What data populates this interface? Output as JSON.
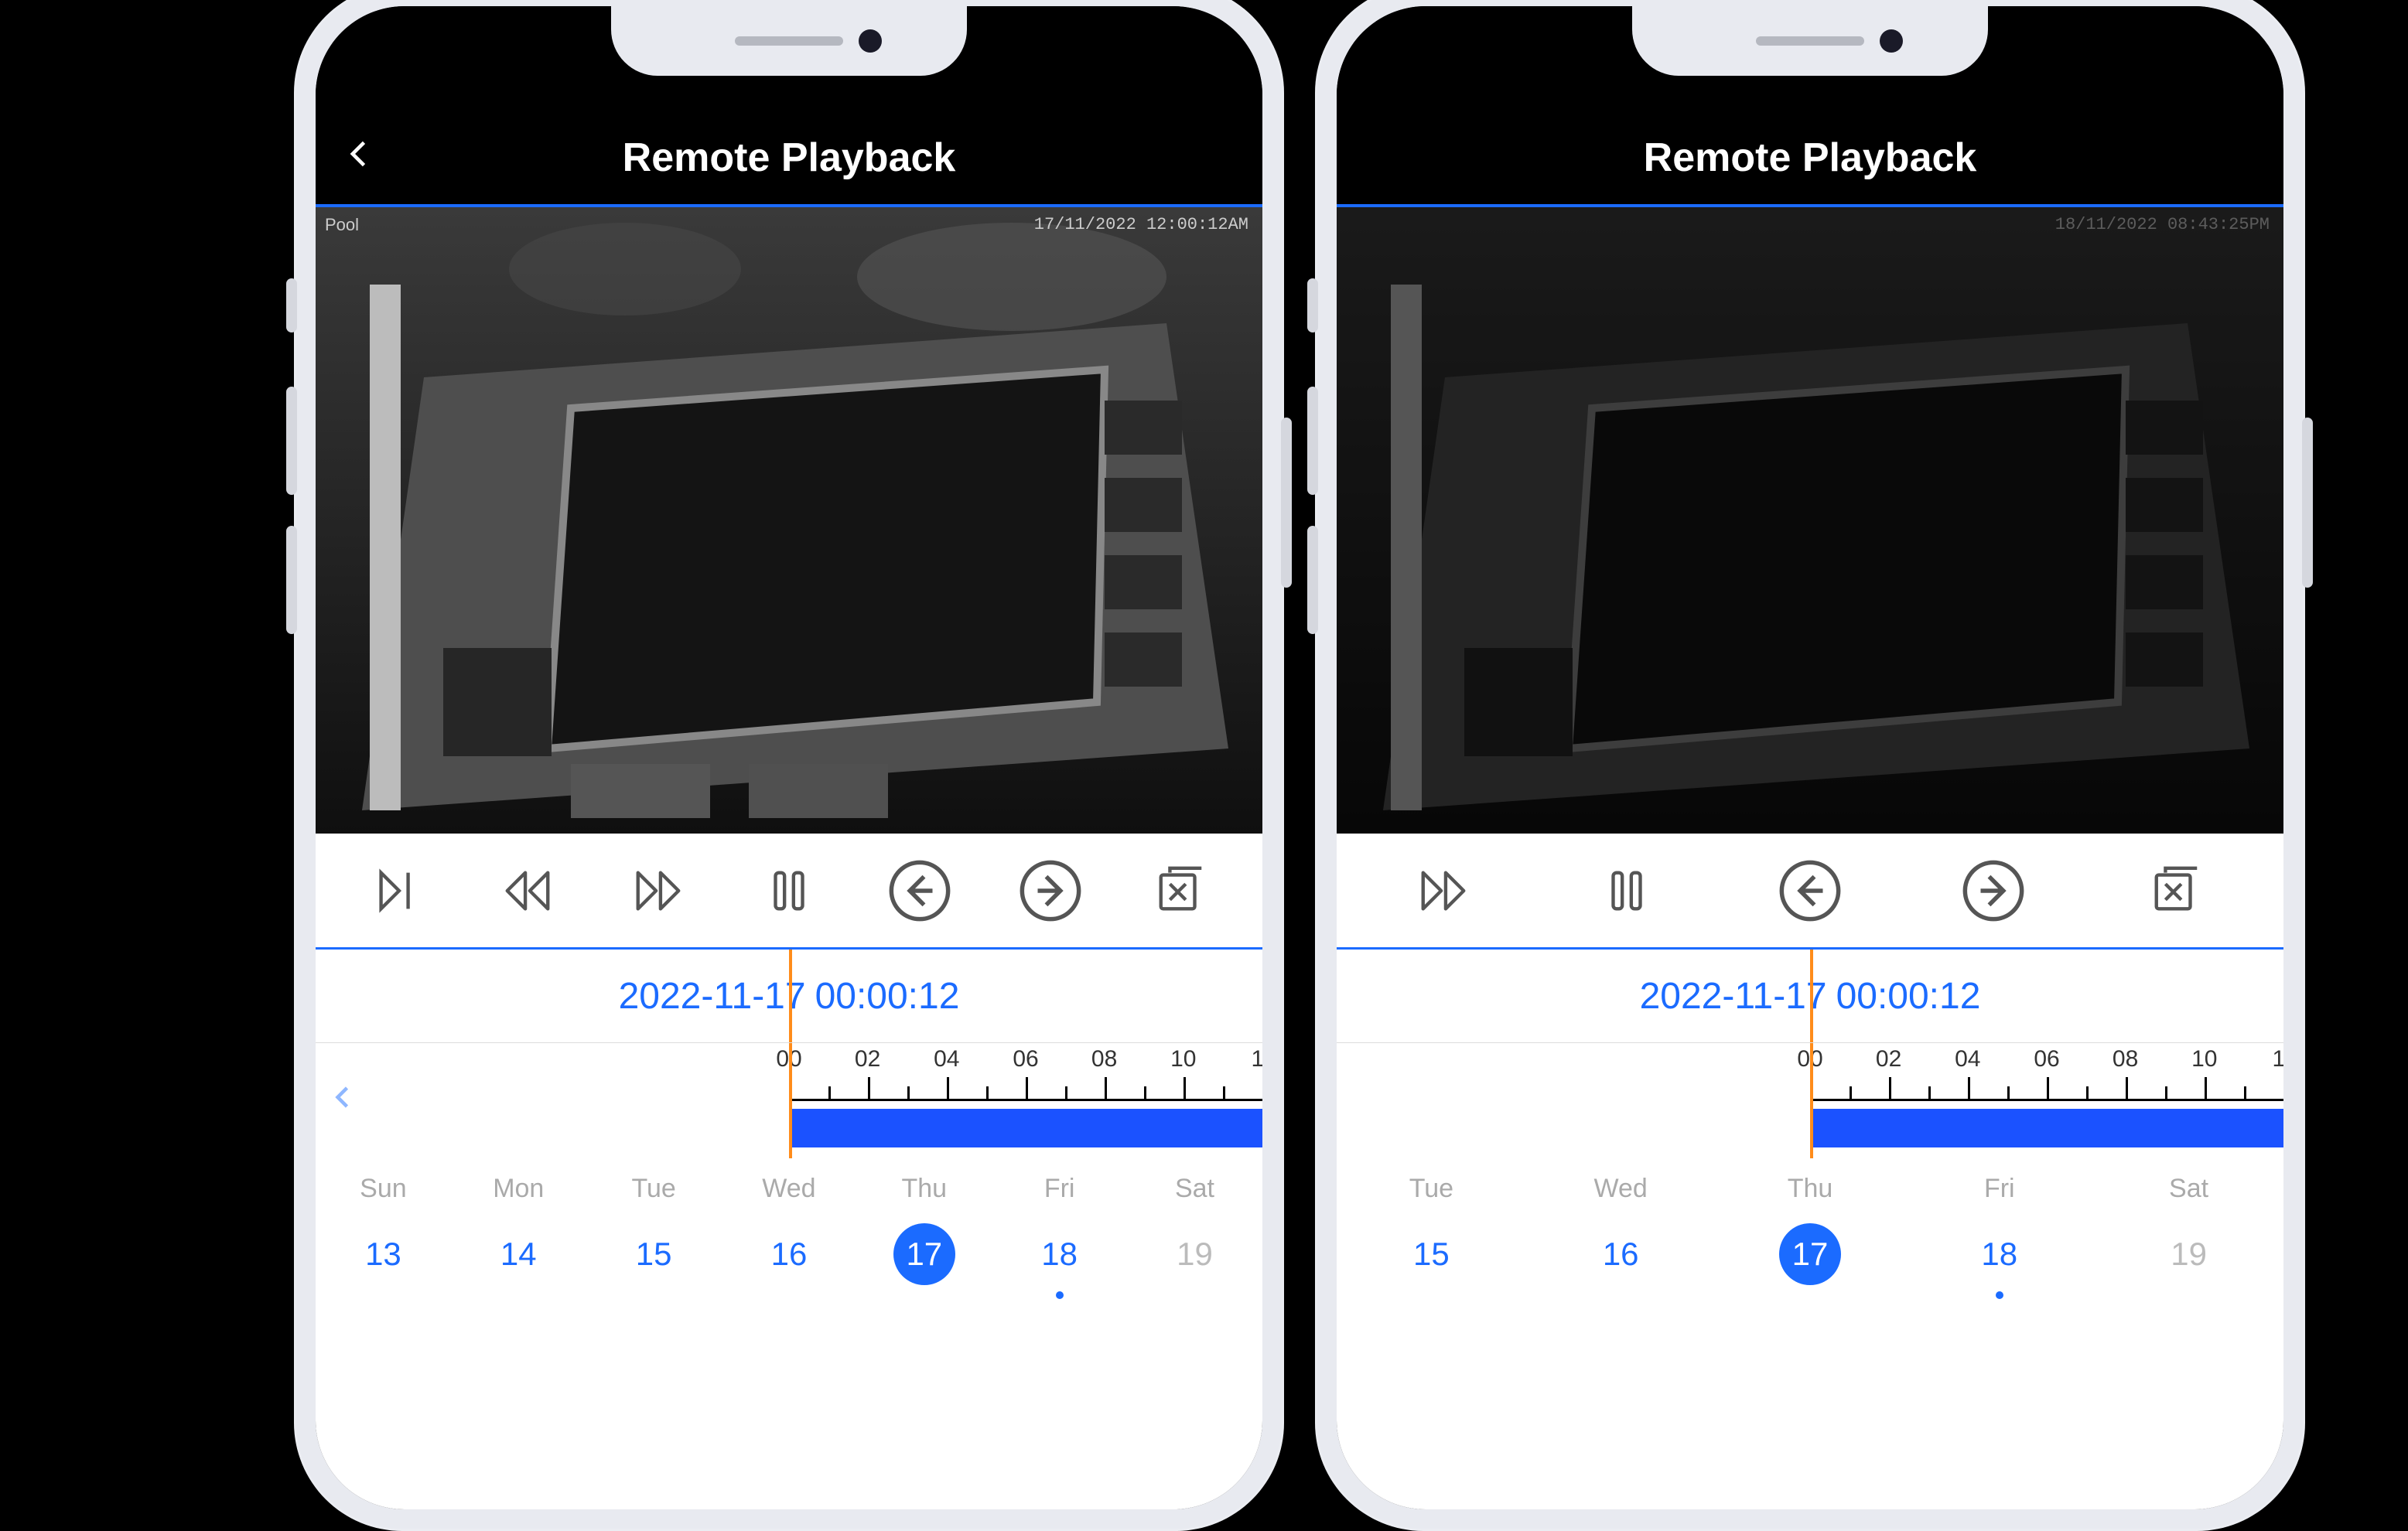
{
  "phones": [
    {
      "header": {
        "title": "Remote Playback",
        "show_back": true
      },
      "video": {
        "label": "Pool",
        "timestamp": "17/11/2022  12:00:12AM",
        "brightness": 1.0
      },
      "controls": {
        "play_frame": "play-frame-icon",
        "rewind": "rewind-icon",
        "forward": "forward-icon",
        "pause": "pause-icon",
        "prev": "arrow-left-circle-icon",
        "next": "arrow-right-circle-icon",
        "close": "close-square-icon"
      },
      "playback": {
        "date": "2022-11-17",
        "time": "00:00:12"
      },
      "timeline": {
        "show_prev_arrow": true,
        "ticks": [
          "00",
          "02",
          "04",
          "06",
          "08",
          "10",
          "1"
        ]
      },
      "days": [
        {
          "name": "Sun",
          "num": "13",
          "state": "normal"
        },
        {
          "name": "Mon",
          "num": "14",
          "state": "normal"
        },
        {
          "name": "Tue",
          "num": "15",
          "state": "normal"
        },
        {
          "name": "Wed",
          "num": "16",
          "state": "normal"
        },
        {
          "name": "Thu",
          "num": "17",
          "state": "selected"
        },
        {
          "name": "Fri",
          "num": "18",
          "state": "dot"
        },
        {
          "name": "Sat",
          "num": "19",
          "state": "disabled"
        }
      ]
    },
    {
      "header": {
        "title": "Remote Playback",
        "show_back": false
      },
      "video": {
        "label": "",
        "timestamp": "18/11/2022  08:43:25PM",
        "brightness": 0.45
      },
      "controls": {
        "play_frame": null,
        "rewind": null,
        "forward": "forward-icon",
        "pause": "pause-icon",
        "prev": "arrow-left-circle-icon",
        "next": "arrow-right-circle-icon",
        "close": "close-square-icon"
      },
      "playback": {
        "date": "2022-11-17",
        "time": "00:00:12"
      },
      "timeline": {
        "show_prev_arrow": false,
        "ticks": [
          "00",
          "02",
          "04",
          "06",
          "08",
          "10",
          "1"
        ]
      },
      "days": [
        {
          "name": "Tue",
          "num": "15",
          "state": "normal"
        },
        {
          "name": "Wed",
          "num": "16",
          "state": "normal"
        },
        {
          "name": "Thu",
          "num": "17",
          "state": "selected"
        },
        {
          "name": "Fri",
          "num": "18",
          "state": "dot"
        },
        {
          "name": "Sat",
          "num": "19",
          "state": "disabled"
        }
      ]
    }
  ]
}
